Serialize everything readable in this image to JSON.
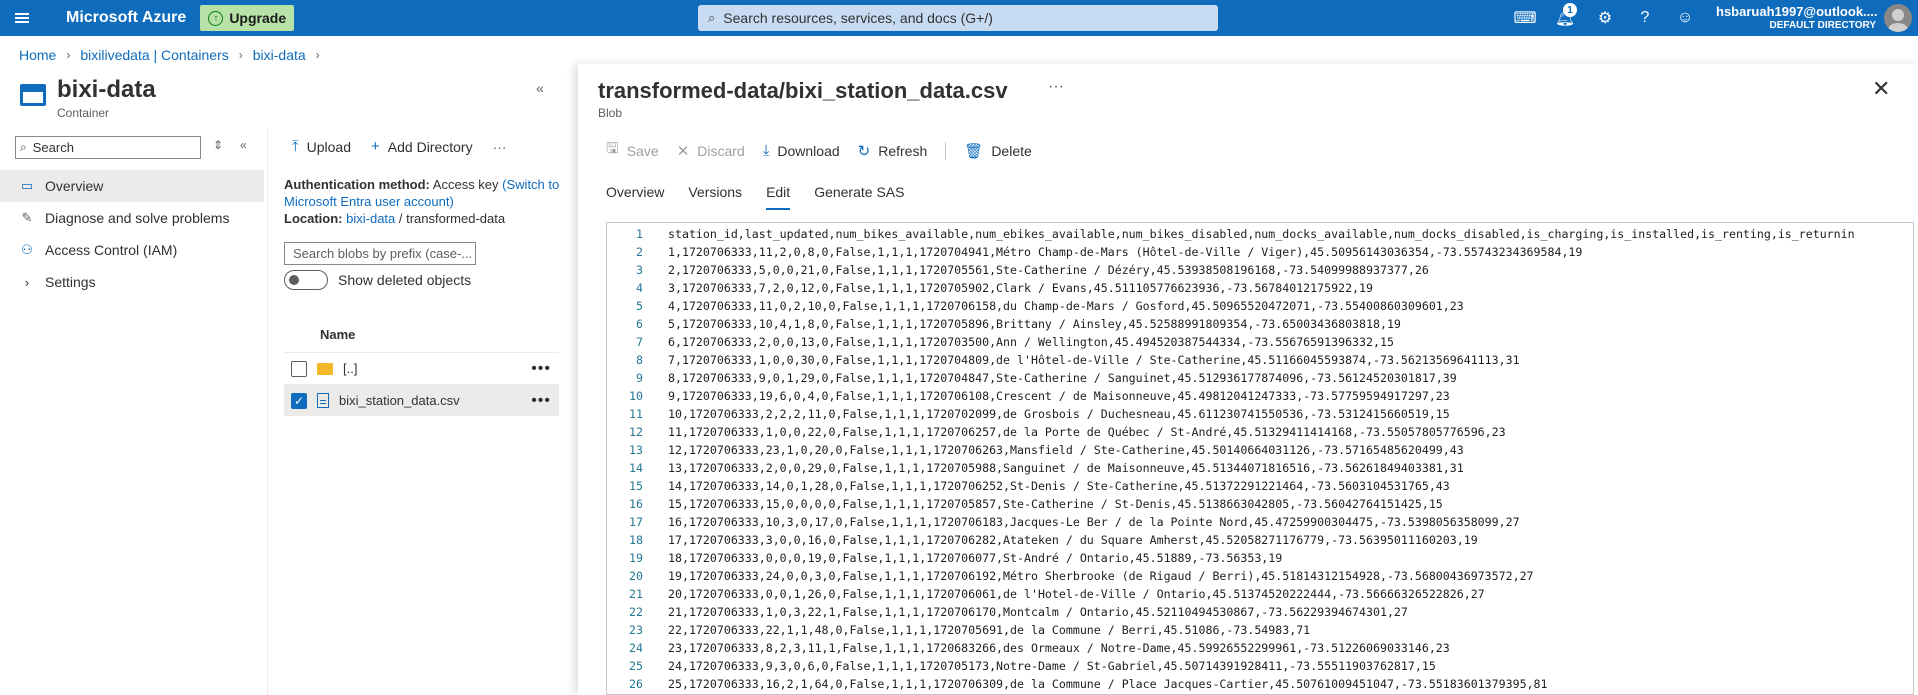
{
  "topbar": {
    "brand": "Microsoft Azure",
    "upgrade_label": "Upgrade",
    "search_placeholder": "Search resources, services, and docs (G+/)",
    "notification_count": "1",
    "account_email": "hsbaruah1997@outlook....",
    "account_directory": "DEFAULT DIRECTORY"
  },
  "breadcrumb": [
    "Home",
    "bixilivedata | Containers",
    "bixi-data"
  ],
  "container": {
    "title": "bixi-data",
    "subtitle": "Container",
    "search_placeholder": "Search",
    "nav": [
      {
        "label": "Overview",
        "icon": "overview-icon"
      },
      {
        "label": "Diagnose and solve problems",
        "icon": "wrench-icon"
      },
      {
        "label": "Access Control (IAM)",
        "icon": "people-icon"
      },
      {
        "label": "Settings",
        "icon": "chevron-right-icon"
      }
    ],
    "toolbar": {
      "upload": "Upload",
      "add_directory": "Add Directory"
    },
    "auth_label": "Authentication method:",
    "auth_value": "Access key",
    "auth_switch": "(Switch to Microsoft Entra user account)",
    "location_label": "Location:",
    "location_link": "bixi-data",
    "location_path": " / transformed-data",
    "prefix_placeholder": "Search blobs by prefix (case-...",
    "show_deleted": "Show deleted objects",
    "grid_header": "Name",
    "rows": [
      {
        "name": "[..]",
        "checked": false
      },
      {
        "name": "bixi_station_data.csv",
        "checked": true
      }
    ]
  },
  "blob": {
    "title": "transformed-data/bixi_station_data.csv",
    "subtitle": "Blob",
    "toolbar": {
      "save": "Save",
      "discard": "Discard",
      "download": "Download",
      "refresh": "Refresh",
      "delete": "Delete"
    },
    "tabs": [
      "Overview",
      "Versions",
      "Edit",
      "Generate SAS"
    ],
    "active_tab": "Edit",
    "lines": [
      "station_id,last_updated,num_bikes_available,num_ebikes_available,num_bikes_disabled,num_docks_available,num_docks_disabled,is_charging,is_installed,is_renting,is_returnin",
      "1,1720706333,11,2,0,8,0,False,1,1,1,1720704941,Métro Champ-de-Mars (Hôtel-de-Ville / Viger),45.50956143036354,-73.55743234369584,19",
      "2,1720706333,5,0,0,21,0,False,1,1,1,1720705561,Ste-Catherine / Dézéry,45.53938508196168,-73.54099988937377,26",
      "3,1720706333,7,2,0,12,0,False,1,1,1,1720705902,Clark / Evans,45.511105776623936,-73.56784012175922,19",
      "4,1720706333,11,0,2,10,0,False,1,1,1,1720706158,du Champ-de-Mars / Gosford,45.50965520472071,-73.55400860309601,23",
      "5,1720706333,10,4,1,8,0,False,1,1,1,1720705896,Brittany / Ainsley,45.52588991809354,-73.65003436803818,19",
      "6,1720706333,2,0,0,13,0,False,1,1,1,1720703500,Ann / Wellington,45.494520387544334,-73.55676591396332,15",
      "7,1720706333,1,0,0,30,0,False,1,1,1,1720704809,de l'Hôtel-de-Ville / Ste-Catherine,45.51166045593874,-73.56213569641113,31",
      "8,1720706333,9,0,1,29,0,False,1,1,1,1720704847,Ste-Catherine / Sanguinet,45.512936177874096,-73.56124520301817,39",
      "9,1720706333,19,6,0,4,0,False,1,1,1,1720706108,Crescent / de Maisonneuve,45.49812041247333,-73.57759594917297,23",
      "10,1720706333,2,2,2,11,0,False,1,1,1,1720702099,de Grosbois / Duchesneau,45.611230741550536,-73.5312415660519,15",
      "11,1720706333,1,0,0,22,0,False,1,1,1,1720706257,de la Porte de Québec / St-André,45.51329411414168,-73.55057805776596,23",
      "12,1720706333,23,1,0,20,0,False,1,1,1,1720706263,Mansfield / Ste-Catherine,45.50140664031126,-73.57165485620499,43",
      "13,1720706333,2,0,0,29,0,False,1,1,1,1720705988,Sanguinet / de Maisonneuve,45.51344071816516,-73.56261849403381,31",
      "14,1720706333,14,0,1,28,0,False,1,1,1,1720706252,St-Denis / Ste-Catherine,45.51372291221464,-73.5603104531765,43",
      "15,1720706333,15,0,0,0,0,False,1,1,1,1720705857,Ste-Catherine / St-Denis,45.5138663042805,-73.56042764151425,15",
      "16,1720706333,10,3,0,17,0,False,1,1,1,1720706183,Jacques-Le Ber / de la Pointe Nord,45.47259900304475,-73.5398056358099,27",
      "17,1720706333,3,0,0,16,0,False,1,1,1,1720706282,Atateken / du Square Amherst,45.52058271176779,-73.56395011160203,19",
      "18,1720706333,0,0,0,19,0,False,1,1,1,1720706077,St-André / Ontario,45.51889,-73.56353,19",
      "19,1720706333,24,0,0,3,0,False,1,1,1,1720706192,Métro Sherbrooke (de Rigaud / Berri),45.51814312154928,-73.56800436973572,27",
      "20,1720706333,0,0,1,26,0,False,1,1,1,1720706061,de l'Hotel-de-Ville / Ontario,45.51374520222444,-73.56666326522826,27",
      "21,1720706333,1,0,3,22,1,False,1,1,1,1720706170,Montcalm / Ontario,45.52110494530867,-73.56229394674301,27",
      "22,1720706333,22,1,1,48,0,False,1,1,1,1720705691,de la Commune / Berri,45.51086,-73.54983,71",
      "23,1720706333,8,2,3,11,1,False,1,1,1,1720683266,des Ormeaux / Notre-Dame,45.59926552299961,-73.51226069033146,23",
      "24,1720706333,9,3,0,6,0,False,1,1,1,1720705173,Notre-Dame / St-Gabriel,45.50714391928411,-73.55511903762817,15",
      "25,1720706333,16,2,1,64,0,False,1,1,1,1720706309,de la Commune / Place Jacques-Cartier,45.50761009451047,-73.55183601379395,81"
    ]
  }
}
